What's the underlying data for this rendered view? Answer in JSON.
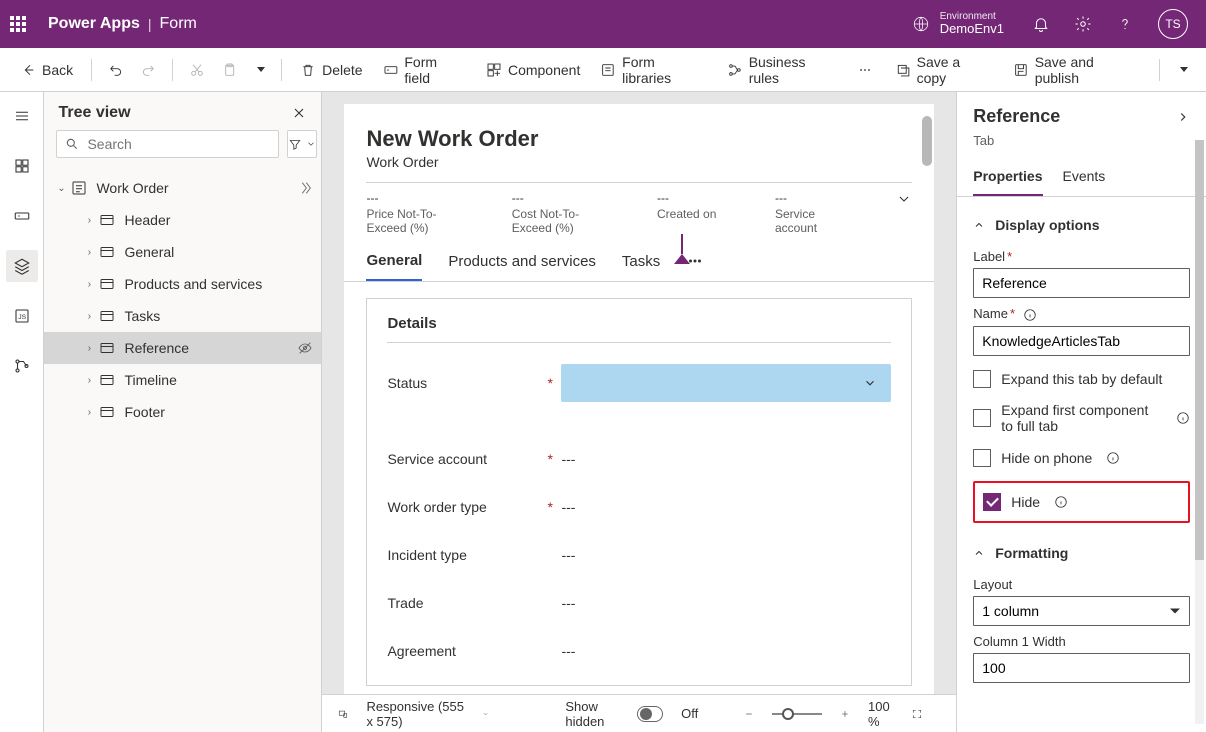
{
  "header": {
    "app_title": "Power Apps",
    "page_title": "Form",
    "environment_label": "Environment",
    "environment_value": "DemoEnv1",
    "avatar_initials": "TS"
  },
  "cmdbar": {
    "back": "Back",
    "delete": "Delete",
    "form_field": "Form field",
    "component": "Component",
    "form_libraries": "Form libraries",
    "business_rules": "Business rules",
    "save_copy": "Save a copy",
    "save_publish": "Save and publish"
  },
  "tree": {
    "title": "Tree view",
    "search_placeholder": "Search",
    "items": [
      {
        "label": "Work Order",
        "depth": 0,
        "chev": "v",
        "type": "form"
      },
      {
        "label": "Header",
        "depth": 1,
        "chev": ">",
        "type": "section"
      },
      {
        "label": "General",
        "depth": 1,
        "chev": ">",
        "type": "section"
      },
      {
        "label": "Products and services",
        "depth": 1,
        "chev": ">",
        "type": "section"
      },
      {
        "label": "Tasks",
        "depth": 1,
        "chev": ">",
        "type": "section"
      },
      {
        "label": "Reference",
        "depth": 1,
        "chev": ">",
        "type": "section",
        "selected": true,
        "hidden": true
      },
      {
        "label": "Timeline",
        "depth": 1,
        "chev": ">",
        "type": "section"
      },
      {
        "label": "Footer",
        "depth": 1,
        "chev": ">",
        "type": "section"
      }
    ]
  },
  "canvas": {
    "form_title": "New Work Order",
    "form_subtitle": "Work Order",
    "header_fields": [
      {
        "value": "---",
        "label": "Price Not-To-Exceed (%)"
      },
      {
        "value": "---",
        "label": "Cost Not-To-Exceed (%)"
      },
      {
        "value": "---",
        "label": "Created on"
      },
      {
        "value": "---",
        "label": "Service account"
      }
    ],
    "tabs": [
      "General",
      "Products and services",
      "Tasks"
    ],
    "section_title": "Details",
    "fields": [
      {
        "label": "Status",
        "required": true,
        "value": "",
        "dropdown": true
      },
      {
        "label": "Service account",
        "required": true,
        "value": "---"
      },
      {
        "label": "Work order type",
        "required": true,
        "value": "---"
      },
      {
        "label": "Incident type",
        "required": false,
        "value": "---"
      },
      {
        "label": "Trade",
        "required": false,
        "value": "---"
      },
      {
        "label": "Agreement",
        "required": false,
        "value": "---"
      }
    ],
    "footer": {
      "responsive": "Responsive (555 x 575)",
      "show_hidden": "Show hidden",
      "toggle_state": "Off",
      "zoom": "100 %"
    }
  },
  "props": {
    "header_title": "Reference",
    "header_sub": "Tab",
    "tabs": [
      "Properties",
      "Events"
    ],
    "display_options_title": "Display options",
    "label_label": "Label",
    "label_value": "Reference",
    "name_label": "Name",
    "name_value": "KnowledgeArticlesTab",
    "expand_default": "Expand this tab by default",
    "expand_first": "Expand first component to full tab",
    "hide_on_phone": "Hide on phone",
    "hide": "Hide",
    "formatting_title": "Formatting",
    "layout_label": "Layout",
    "layout_value": "1 column",
    "col_width_label": "Column 1 Width",
    "col_width_value": "100"
  }
}
